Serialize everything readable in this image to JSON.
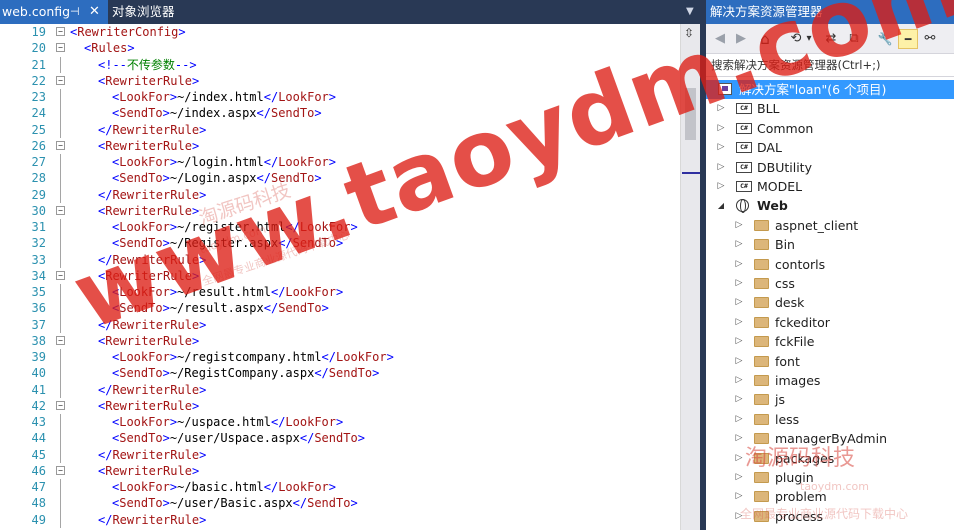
{
  "editor": {
    "tabs": {
      "active": "web.config",
      "pin": "⊣",
      "close": "✕",
      "other": "对象浏览器",
      "dropdown": "▼"
    },
    "lines": [
      {
        "n": "19",
        "fold": "⊟",
        "indent": 1,
        "code": "<RewriterConfig>"
      },
      {
        "n": "20",
        "fold": "⊟",
        "indent": 2,
        "code": "<Rules>"
      },
      {
        "n": "21",
        "fold": "",
        "indent": 3,
        "code": "<!--不传参数-->"
      },
      {
        "n": "22",
        "fold": "⊟",
        "indent": 3,
        "code": "<RewriterRule>"
      },
      {
        "n": "23",
        "fold": "",
        "indent": 4,
        "code": "<LookFor>~/index.html</LookFor>"
      },
      {
        "n": "24",
        "fold": "",
        "indent": 4,
        "code": "<SendTo>~/index.aspx</SendTo>"
      },
      {
        "n": "25",
        "fold": "",
        "indent": 3,
        "code": "</RewriterRule>"
      },
      {
        "n": "26",
        "fold": "⊟",
        "indent": 3,
        "code": "<RewriterRule>"
      },
      {
        "n": "27",
        "fold": "",
        "indent": 4,
        "code": "<LookFor>~/login.html</LookFor>"
      },
      {
        "n": "28",
        "fold": "",
        "indent": 4,
        "code": "<SendTo>~/Login.aspx</SendTo>"
      },
      {
        "n": "29",
        "fold": "",
        "indent": 3,
        "code": "</RewriterRule>"
      },
      {
        "n": "30",
        "fold": "⊟",
        "indent": 3,
        "code": "<RewriterRule>"
      },
      {
        "n": "31",
        "fold": "",
        "indent": 4,
        "code": "<LookFor>~/register.html</LookFor>"
      },
      {
        "n": "32",
        "fold": "",
        "indent": 4,
        "code": "<SendTo>~/Register.aspx</SendTo>"
      },
      {
        "n": "33",
        "fold": "",
        "indent": 3,
        "code": "</RewriterRule>"
      },
      {
        "n": "34",
        "fold": "⊟",
        "indent": 3,
        "code": "<RewriterRule>"
      },
      {
        "n": "35",
        "fold": "",
        "indent": 4,
        "code": "<LookFor>~/result.html</LookFor>"
      },
      {
        "n": "36",
        "fold": "",
        "indent": 4,
        "code": "<SendTo>~/result.aspx</SendTo>"
      },
      {
        "n": "37",
        "fold": "",
        "indent": 3,
        "code": "</RewriterRule>"
      },
      {
        "n": "38",
        "fold": "⊟",
        "indent": 3,
        "code": "<RewriterRule>"
      },
      {
        "n": "39",
        "fold": "",
        "indent": 4,
        "code": "<LookFor>~/registcompany.html</LookFor>"
      },
      {
        "n": "40",
        "fold": "",
        "indent": 4,
        "code": "<SendTo>~/RegistCompany.aspx</SendTo>"
      },
      {
        "n": "41",
        "fold": "",
        "indent": 3,
        "code": "</RewriterRule>"
      },
      {
        "n": "42",
        "fold": "⊟",
        "indent": 3,
        "code": "<RewriterRule>"
      },
      {
        "n": "43",
        "fold": "",
        "indent": 4,
        "code": "<LookFor>~/uspace.html</LookFor>"
      },
      {
        "n": "44",
        "fold": "",
        "indent": 4,
        "code": "<SendTo>~/user/Uspace.aspx</SendTo>"
      },
      {
        "n": "45",
        "fold": "",
        "indent": 3,
        "code": "</RewriterRule>"
      },
      {
        "n": "46",
        "fold": "⊟",
        "indent": 3,
        "code": "<RewriterRule>"
      },
      {
        "n": "47",
        "fold": "",
        "indent": 4,
        "code": "<LookFor>~/basic.html</LookFor>"
      },
      {
        "n": "48",
        "fold": "",
        "indent": 4,
        "code": "<SendTo>~/user/Basic.aspx</SendTo>"
      },
      {
        "n": "49",
        "fold": "",
        "indent": 3,
        "code": "</RewriterRule>"
      }
    ],
    "scroll_split_icon": "⇳"
  },
  "solution_explorer": {
    "title": "解决方案资源管理器",
    "toolbar": {
      "back": "◀",
      "forward": "▶",
      "home": "⌂",
      "history": "⟲",
      "dropdown": "▾",
      "sync": "⇄",
      "collapse": "⧉",
      "properties": "🔧",
      "pin": "━",
      "hierarchy": "⚯"
    },
    "search_placeholder": "搜索解决方案资源管理器(Ctrl+;)",
    "solution_label": "解决方案\"loan\"(6 个项目)",
    "items": [
      {
        "level": 1,
        "kind": "project",
        "expand": "▷",
        "label": "BLL"
      },
      {
        "level": 1,
        "kind": "project",
        "expand": "▷",
        "label": "Common"
      },
      {
        "level": 1,
        "kind": "project",
        "expand": "▷",
        "label": "DAL"
      },
      {
        "level": 1,
        "kind": "project",
        "expand": "▷",
        "label": "DBUtility"
      },
      {
        "level": 1,
        "kind": "project",
        "expand": "▷",
        "label": "MODEL"
      },
      {
        "level": 1,
        "kind": "web",
        "expand": "◢",
        "label": "Web",
        "bold": true
      },
      {
        "level": 2,
        "kind": "folder",
        "expand": "▷",
        "label": "aspnet_client"
      },
      {
        "level": 2,
        "kind": "folder",
        "expand": "▷",
        "label": "Bin"
      },
      {
        "level": 2,
        "kind": "folder",
        "expand": "▷",
        "label": "contorls"
      },
      {
        "level": 2,
        "kind": "folder",
        "expand": "▷",
        "label": "css"
      },
      {
        "level": 2,
        "kind": "folder",
        "expand": "▷",
        "label": "desk"
      },
      {
        "level": 2,
        "kind": "folder",
        "expand": "▷",
        "label": "fckeditor"
      },
      {
        "level": 2,
        "kind": "folder",
        "expand": "▷",
        "label": "fckFile"
      },
      {
        "level": 2,
        "kind": "folder",
        "expand": "▷",
        "label": "font"
      },
      {
        "level": 2,
        "kind": "folder",
        "expand": "▷",
        "label": "images"
      },
      {
        "level": 2,
        "kind": "folder",
        "expand": "▷",
        "label": "js"
      },
      {
        "level": 2,
        "kind": "folder",
        "expand": "▷",
        "label": "less"
      },
      {
        "level": 2,
        "kind": "folder",
        "expand": "▷",
        "label": "managerByAdmin"
      },
      {
        "level": 2,
        "kind": "folder",
        "expand": "▷",
        "label": "packages"
      },
      {
        "level": 2,
        "kind": "folder",
        "expand": "▷",
        "label": "plugin"
      },
      {
        "level": 2,
        "kind": "folder",
        "expand": "▷",
        "label": "problem"
      },
      {
        "level": 2,
        "kind": "folder",
        "expand": "▷",
        "label": "process"
      }
    ]
  },
  "watermarks": {
    "main": "www.taoydm.com",
    "small_1": "淘源码科技",
    "small_2": "taoydm.com",
    "small_3": "全网最专业商业源代码下载中心",
    "small_4": "淘源码科技",
    "small_5": "taoydm.com",
    "small_6": "全网最专业商业源代码下载中心"
  },
  "colors": {
    "tab_bar": "#293955",
    "accent": "#2d6dbf",
    "selection": "#3399ff",
    "xml_tag": "#a31515",
    "xml_bracket": "#0000ff",
    "comment": "#008000",
    "line_number": "#2b91af",
    "watermark": "#dc1e14"
  }
}
